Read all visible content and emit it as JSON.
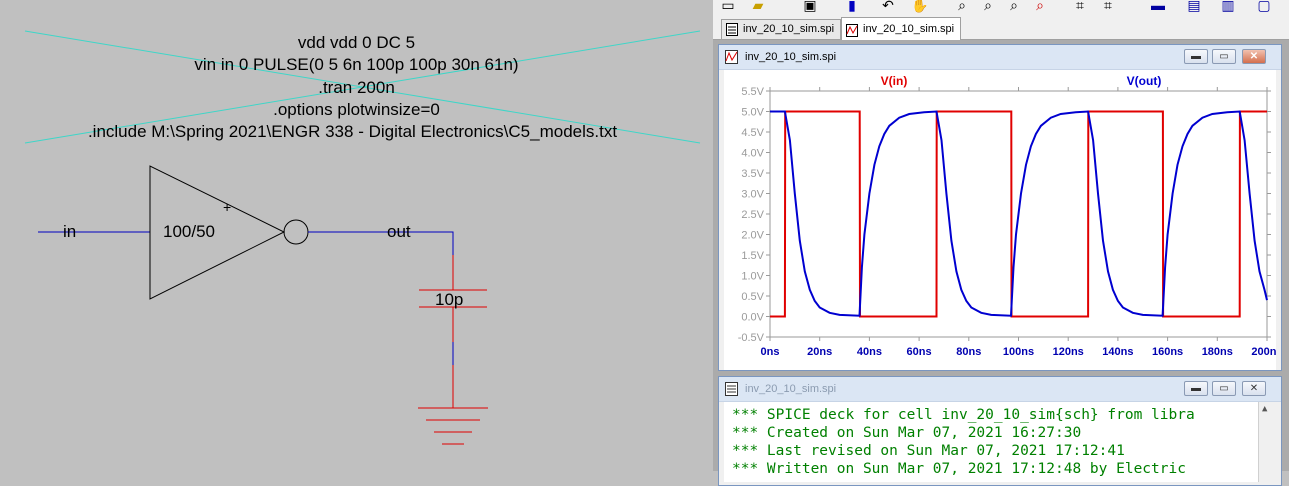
{
  "schematic": {
    "directives": [
      "vdd vdd 0 DC 5",
      "vin in 0 PULSE(0 5 6n 100p 100p 30n 61n)",
      ".tran 200n",
      ".options plotwinsize=0",
      ".include M:\\Spring 2021\\ENGR 338 - Digital Electronics\\C5_models.txt"
    ],
    "input_net": "in",
    "inverter_size": "100/50",
    "inverter_plus": "+",
    "output_net": "out",
    "capacitor_value": "10p"
  },
  "tabs": [
    {
      "label": "inv_20_10_sim.spi",
      "icon": "text-file-icon",
      "active": false
    },
    {
      "label": "inv_20_10_sim.spi",
      "icon": "waveform-icon",
      "active": true
    }
  ],
  "plot_window": {
    "title": "inv_20_10_sim.spi",
    "icon": "waveform-icon",
    "buttons": {
      "minimize": "minimize-icon",
      "restore": "restore-icon",
      "close": "close-icon"
    }
  },
  "chart_data": {
    "type": "line",
    "x_unit": "ns",
    "y_unit": "V",
    "xlim": [
      0,
      200
    ],
    "ylim": [
      -0.5,
      5.5
    ],
    "x_ticks": [
      "0ns",
      "20ns",
      "40ns",
      "60ns",
      "80ns",
      "100ns",
      "120ns",
      "140ns",
      "160ns",
      "180ns",
      "200ns"
    ],
    "y_ticks": [
      "5.5V",
      "5.0V",
      "4.5V",
      "4.0V",
      "3.5V",
      "3.0V",
      "2.5V",
      "2.0V",
      "1.5V",
      "1.0V",
      "0.5V",
      "0.0V",
      "-0.5V"
    ],
    "grid": false,
    "series": [
      {
        "name": "V(in)",
        "color": "#e00000",
        "points": [
          [
            0,
            0
          ],
          [
            6,
            0
          ],
          [
            6.1,
            5
          ],
          [
            36.1,
            5
          ],
          [
            36.2,
            0
          ],
          [
            67,
            0
          ],
          [
            67.1,
            5
          ],
          [
            97.1,
            5
          ],
          [
            97.2,
            0
          ],
          [
            128,
            0
          ],
          [
            128.1,
            5
          ],
          [
            158.1,
            5
          ],
          [
            158.2,
            0
          ],
          [
            189,
            0
          ],
          [
            189.1,
            5
          ],
          [
            200,
            5
          ]
        ]
      },
      {
        "name": "V(out)",
        "color": "#0000d0",
        "points": [
          [
            0,
            5
          ],
          [
            6,
            5
          ],
          [
            8,
            4.3
          ],
          [
            10,
            3.0
          ],
          [
            12,
            1.85
          ],
          [
            14,
            1.1
          ],
          [
            16,
            0.65
          ],
          [
            18,
            0.38
          ],
          [
            20,
            0.22
          ],
          [
            24,
            0.09
          ],
          [
            28,
            0.04
          ],
          [
            36,
            0.02
          ],
          [
            37,
            1.2
          ],
          [
            38,
            2.0
          ],
          [
            40,
            3.0
          ],
          [
            42,
            3.7
          ],
          [
            44,
            4.15
          ],
          [
            46,
            4.45
          ],
          [
            48,
            4.65
          ],
          [
            52,
            4.85
          ],
          [
            56,
            4.94
          ],
          [
            62,
            4.98
          ],
          [
            67,
            5
          ],
          [
            69,
            4.3
          ],
          [
            71,
            3.0
          ],
          [
            73,
            1.85
          ],
          [
            75,
            1.1
          ],
          [
            77,
            0.65
          ],
          [
            79,
            0.38
          ],
          [
            81,
            0.22
          ],
          [
            85,
            0.09
          ],
          [
            89,
            0.04
          ],
          [
            97,
            0.02
          ],
          [
            98,
            1.2
          ],
          [
            99,
            2.0
          ],
          [
            101,
            3.0
          ],
          [
            103,
            3.7
          ],
          [
            105,
            4.15
          ],
          [
            107,
            4.45
          ],
          [
            109,
            4.65
          ],
          [
            113,
            4.85
          ],
          [
            117,
            4.94
          ],
          [
            123,
            4.98
          ],
          [
            128,
            5
          ],
          [
            130,
            4.3
          ],
          [
            132,
            3.0
          ],
          [
            134,
            1.85
          ],
          [
            136,
            1.1
          ],
          [
            138,
            0.65
          ],
          [
            140,
            0.38
          ],
          [
            142,
            0.22
          ],
          [
            146,
            0.09
          ],
          [
            150,
            0.04
          ],
          [
            158,
            0.02
          ],
          [
            159,
            1.2
          ],
          [
            160,
            2.0
          ],
          [
            162,
            3.0
          ],
          [
            164,
            3.7
          ],
          [
            166,
            4.15
          ],
          [
            168,
            4.45
          ],
          [
            170,
            4.65
          ],
          [
            174,
            4.85
          ],
          [
            178,
            4.94
          ],
          [
            184,
            4.98
          ],
          [
            189,
            5
          ],
          [
            191,
            4.3
          ],
          [
            193,
            3.0
          ],
          [
            195,
            1.85
          ],
          [
            197,
            1.1
          ],
          [
            199,
            0.65
          ],
          [
            200,
            0.4
          ]
        ]
      }
    ]
  },
  "netlist_window": {
    "title": "inv_20_10_sim.spi",
    "icon": "text-file-icon",
    "lines": [
      "*** SPICE deck for cell inv_20_10_sim{sch} from libra",
      "*** Created on Sun Mar 07, 2021 16:27:30",
      "*** Last revised on Sun Mar 07, 2021 17:12:41",
      "*** Written on Sun Mar 07, 2021 17:12:48 by Electric"
    ]
  },
  "toolbar": {
    "icons": [
      "button-icon",
      "open-folder-icon",
      "save-icon",
      "probe-icon",
      "undo-icon",
      "pan-hand-icon",
      "zoom-in-icon",
      "zoom-out-icon",
      "zoom-fit-icon",
      "zoom-cancel-icon",
      "autorange-icon",
      "autorange-y-icon",
      "tile-horizontal-icon",
      "cascade-icon",
      "tile-vertical-icon",
      "window-icon"
    ]
  }
}
